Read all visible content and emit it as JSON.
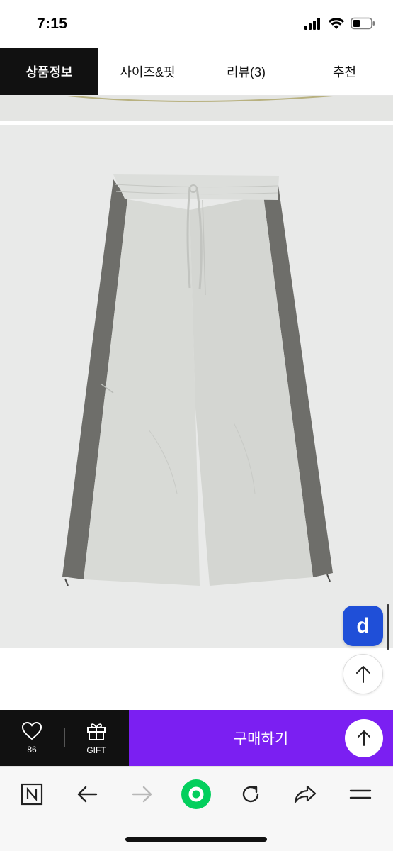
{
  "status_bar": {
    "time": "7:15",
    "icons": [
      "signal-icon",
      "wifi-icon",
      "battery-icon"
    ]
  },
  "tabs": [
    {
      "label": "상품정보",
      "active": true
    },
    {
      "label": "사이즈&핏",
      "active": false
    },
    {
      "label": "리뷰(3)",
      "active": false
    },
    {
      "label": "추천",
      "active": false
    }
  ],
  "product_image": {
    "icon": "wide-nylon-pants-image",
    "background_color": "#e9eae9",
    "panel_color": "#6e6e6a",
    "pants_color": "#d7d9d5"
  },
  "floating": {
    "badge_letter": "d",
    "badge_color": "#1f4fd8",
    "scroll_top_icon": "arrow-up-icon"
  },
  "purchase_bar": {
    "like_icon": "heart-icon",
    "like_count": "86",
    "gift_icon": "gift-icon",
    "gift_label": "GIFT",
    "buy_label": "구매하기",
    "buy_color": "#7b1ff2",
    "scroll_top_icon": "arrow-up-icon"
  },
  "browser_toolbar": {
    "items": [
      "naver-n-icon",
      "back-arrow-icon",
      "forward-arrow-icon",
      "home-circle-icon",
      "reload-icon",
      "share-icon",
      "menu-icon"
    ],
    "accent": "#03cf5d"
  }
}
